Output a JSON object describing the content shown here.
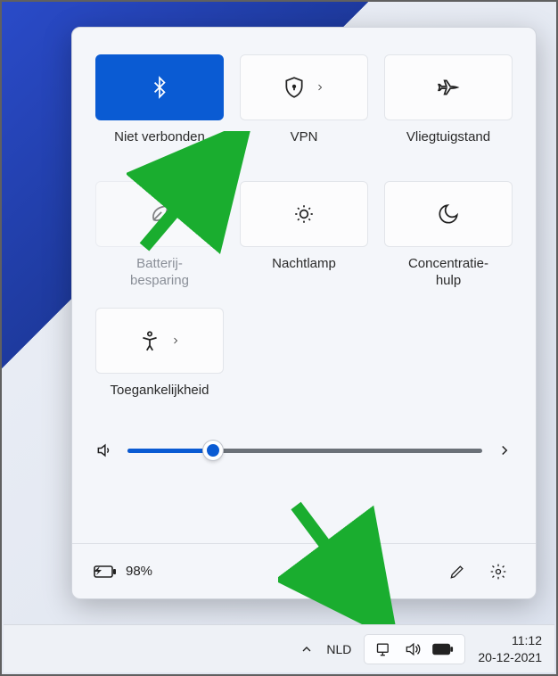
{
  "tiles": [
    {
      "label": "Niet verbonden",
      "active": true,
      "disabled": false
    },
    {
      "label": "VPN",
      "active": false,
      "disabled": false
    },
    {
      "label": "Vliegtuigstand",
      "active": false,
      "disabled": false
    },
    {
      "label": "Batterij-\nbesparing",
      "active": false,
      "disabled": true
    },
    {
      "label": "Nachtlamp",
      "active": false,
      "disabled": false
    },
    {
      "label": "Concentratie-\nhulp",
      "active": false,
      "disabled": false
    },
    {
      "label": "Toegankelijkheid",
      "active": false,
      "disabled": false
    }
  ],
  "volume": {
    "percent": 24
  },
  "battery": {
    "text": "98%"
  },
  "taskbar": {
    "language": "NLD",
    "time": "11:12",
    "date": "20-12-2021"
  },
  "colors": {
    "accent": "#0a5bd3",
    "arrow": "#1aad2f"
  }
}
